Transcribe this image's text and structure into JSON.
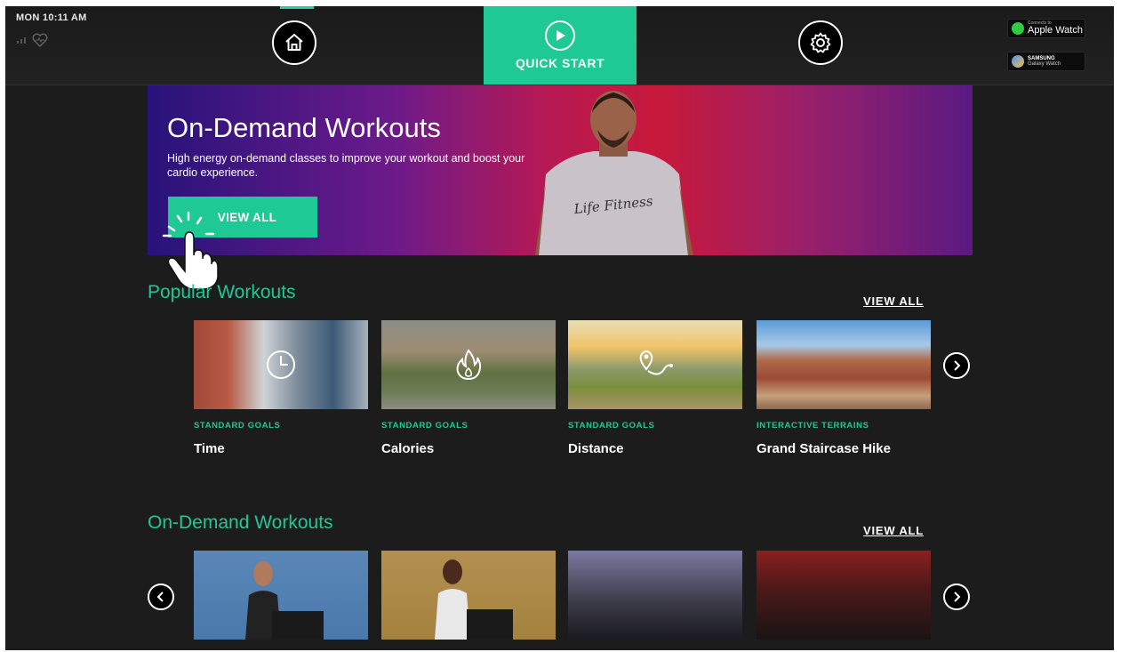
{
  "topbar": {
    "clock": "MON 10:11 AM",
    "home_icon": "home-icon",
    "quick_start": "QUICK START",
    "settings_icon": "gear-icon",
    "apple_watch": {
      "small": "Connects to",
      "label": "Apple Watch"
    },
    "samsung": {
      "brand": "SAMSUNG",
      "label": "Galaxy Watch"
    }
  },
  "hero": {
    "title": "On-Demand Workouts",
    "description": "High energy on-demand classes to improve your workout and boost your cardio experience.",
    "button": "VIEW ALL",
    "shirt_text": "Life Fitness"
  },
  "popular": {
    "title": "Popular Workouts",
    "view_all": "VIEW ALL",
    "items": [
      {
        "category": "STANDARD GOALS",
        "name": "Time",
        "icon": "clock-icon"
      },
      {
        "category": "STANDARD GOALS",
        "name": "Calories",
        "icon": "flame-icon"
      },
      {
        "category": "STANDARD GOALS",
        "name": "Distance",
        "icon": "route-icon"
      },
      {
        "category": "INTERACTIVE TERRAINS",
        "name": "Grand Staircase Hike",
        "icon": ""
      }
    ]
  },
  "ondemand": {
    "title": "On-Demand Workouts",
    "view_all": "VIEW ALL"
  },
  "colors": {
    "accent": "#1fc995",
    "background": "#1c1c1c"
  }
}
